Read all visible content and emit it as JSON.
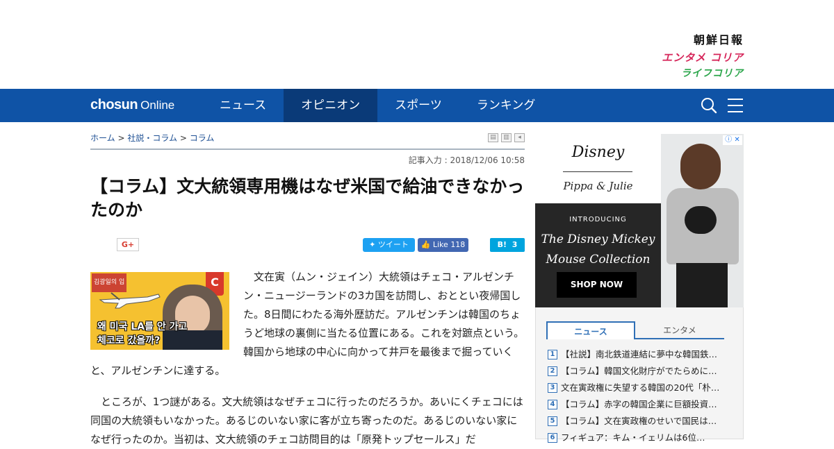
{
  "brands": {
    "main": "朝鮮日報",
    "enta": "エンタメ コリア",
    "life": "ライフコリア"
  },
  "nav": {
    "logo_bold": "chosun",
    "logo_light": "Online",
    "items": [
      "ニュース",
      "オピニオン",
      "スポーツ",
      "ランキング"
    ],
    "active_item": "オピニオン",
    "search_icon": "search-icon",
    "menu_icon": "hamburger-icon"
  },
  "breadcrumb": {
    "home": "ホーム",
    "sep": ">",
    "level1": "社説・コラム",
    "level2": "コラム"
  },
  "article": {
    "dateline": "記事入力 : 2018/12/06 10:58",
    "title": "【コラム】文大統領専用機はなぜ米国で給油できなかったのか",
    "thumb_tag": "김광일의 입",
    "thumb_line1": "왜 미국 LA를 안 가고",
    "thumb_line2": "체코로 갔을까?",
    "para1": "文在寅（ムン・ジェイン）大統領はチェコ・アルゼンチン・ニュージーランドの3カ国を訪問し、おととい夜帰国した。8日間にわたる海外歴訪だ。アルゼンチンは韓国のちょうど地球の裏側に当たる位置にある。これを対蹠点という。韓国から地球の中心に向かって井戸を最後まで掘っていくと、アルゼンチンに達する。",
    "para2": "ところが、1つ謎がある。文大統領はなぜチェコに行ったのだろうか。あいにくチェコには同国の大統領もいなかった。あるじのいない家に客が立ち寄ったのだ。あるじのいない家になぜ行ったのか。当初は、文大統領のチェコ訪問目的は「原発トップセールス」だ"
  },
  "share": {
    "gplus": "G+",
    "tweet": "ツイート",
    "fb_label": "Like",
    "fb_count": "118",
    "hatena_label": "B!",
    "hatena_count": "3"
  },
  "ad": {
    "disney": "Disney",
    "pippa": "Pippa & Julie",
    "intro": "INTRODUCING",
    "collection_line1": "The Disney Mickey",
    "collection_line2": "Mouse Collection",
    "shop": "SHOP NOW"
  },
  "ranking": {
    "tabs": [
      "ニュース",
      "エンタメ"
    ],
    "items": [
      {
        "num": "1",
        "text": "【社説】南北鉄道連結に夢中な韓国鉄…"
      },
      {
        "num": "2",
        "text": "【コラム】韓国文化財庁がでたらめに…"
      },
      {
        "num": "3",
        "text": "文在寅政権に失望する韓国の20代「朴…"
      },
      {
        "num": "4",
        "text": "【コラム】赤字の韓国企業に巨額投資…"
      },
      {
        "num": "5",
        "text": "【コラム】文在寅政権のせいで国民は…"
      },
      {
        "num": "6",
        "text": "フィギュア：キム・イェリムは6位…"
      }
    ]
  },
  "colors": {
    "nav_bg": "#0f53a6",
    "nav_active": "#0a3a78",
    "accent_blue": "#2f6fb6"
  }
}
